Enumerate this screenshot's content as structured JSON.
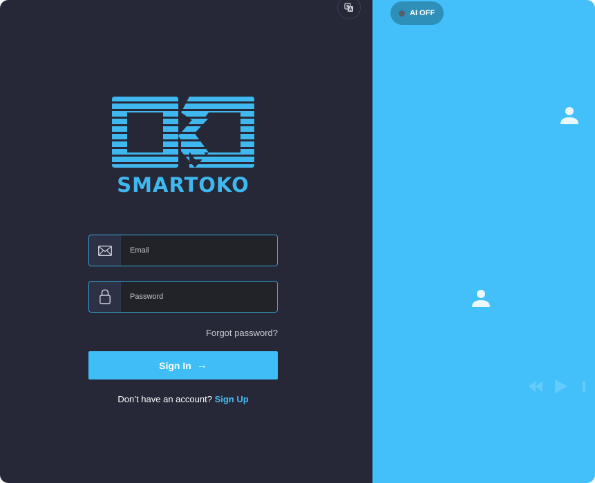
{
  "header": {
    "translate_icon": "translate-icon"
  },
  "brand": {
    "logo_text": "SMARTOKO"
  },
  "login": {
    "email_placeholder": "Email",
    "password_placeholder": "Password",
    "forgot_label": "Forgot password?",
    "signin_label": "Sign In",
    "signup_prompt": "Don’t have an account?",
    "signup_label": "Sign Up"
  },
  "ai_toggle": {
    "label": "AI OFF",
    "state": "off"
  },
  "colors": {
    "left_bg": "#262837",
    "accent": "#3fbdf6",
    "right_bg": "#43c0f9",
    "toggle_bg": "#2e8fb9"
  }
}
